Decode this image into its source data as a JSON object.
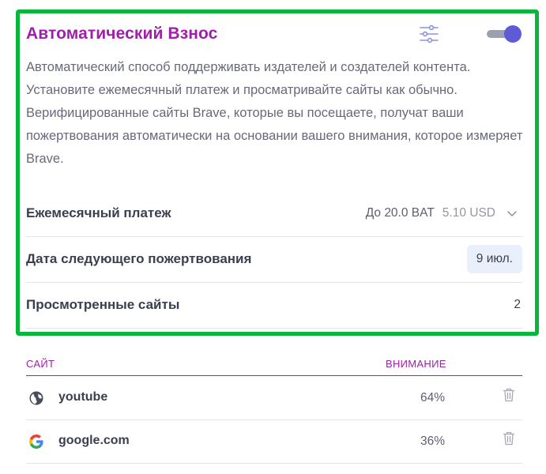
{
  "auto_contribute": {
    "title": "Автоматический Взнос",
    "enabled": true,
    "description": "Автоматический способ поддерживать издателей и создателей контента. Установите ежемесячный платеж и просматривайте сайты как обычно. Верифицированные сайты Brave, которые вы посещаете, получат ваши пожертвования автоматически на основании вашего внимания, которое измеряет Brave.",
    "settings_icon": "sliders-icon",
    "accent_color": "#9e1fa8",
    "toggle_color": "#5f5bd6",
    "highlight_color": "#0ab53b"
  },
  "rows": {
    "monthly_payment": {
      "label": "Ежемесячный платеж",
      "bat": "До 20.0 BAT",
      "usd": "5.10 USD"
    },
    "next_contribution": {
      "label": "Дата следующего пожертвования",
      "date": "9 июл."
    },
    "sites_viewed": {
      "label": "Просмотренные сайты",
      "count": "2"
    }
  },
  "table": {
    "col_site": "САЙТ",
    "col_attention": "ВНИМАНИЕ",
    "rows": [
      {
        "site": "youtube",
        "attention": "64%",
        "icon": "globe-icon"
      },
      {
        "site": "google.com",
        "attention": "36%",
        "icon": "google-icon"
      }
    ]
  }
}
